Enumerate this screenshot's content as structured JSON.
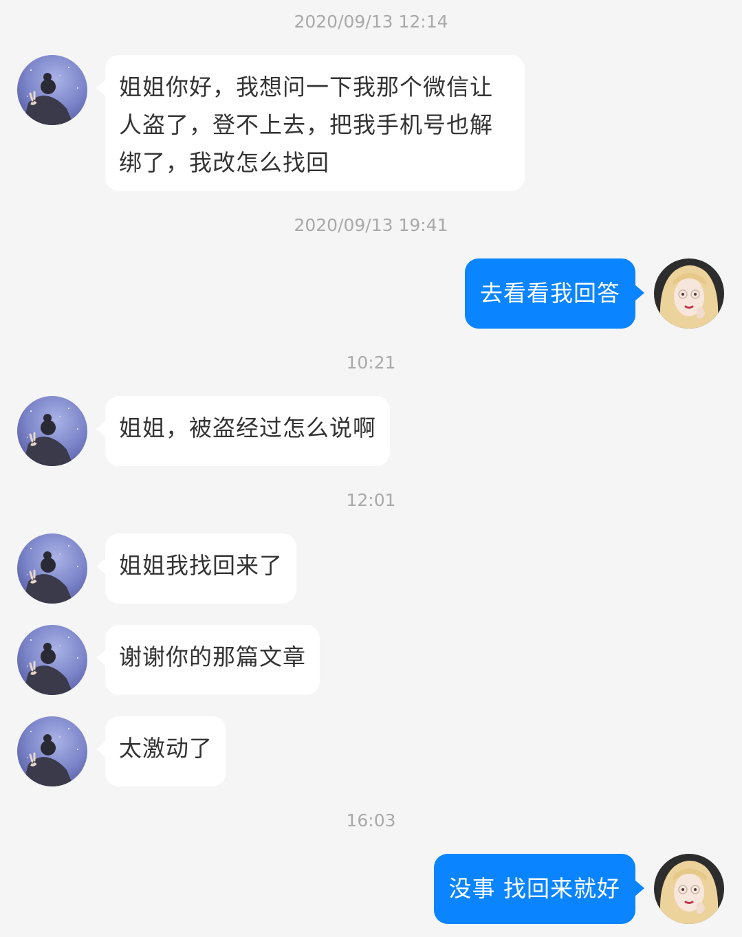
{
  "timestamps": [
    "2020/09/13 12:14",
    "2020/09/13 19:41",
    "10:21",
    "12:01",
    "16:03"
  ],
  "messages": [
    {
      "text": "姐姐你好，我想问一下我那个微信让\n人盗了，登不上去，把我手机号也解\n绑了，我改怎么找回",
      "side": "incoming"
    },
    {
      "text": "去看看我回答",
      "side": "outgoing"
    },
    {
      "text": "姐姐，被盗经过怎么说啊",
      "side": "incoming"
    },
    {
      "text": "姐姐我找回来了",
      "side": "incoming"
    },
    {
      "text": "谢谢你的那篇文章",
      "side": "incoming"
    },
    {
      "text": "太激动了",
      "side": "incoming"
    },
    {
      "text": "没事 找回来就好",
      "side": "outgoing"
    }
  ],
  "colors": {
    "background": "#f5f5f5",
    "incoming_bubble": "#ffffff",
    "outgoing_bubble": "#0a84ff",
    "timestamp_text": "#a9a9a9"
  },
  "icons": {
    "contact_avatar": "contact-avatar-icon",
    "self_avatar": "self-avatar-icon"
  }
}
